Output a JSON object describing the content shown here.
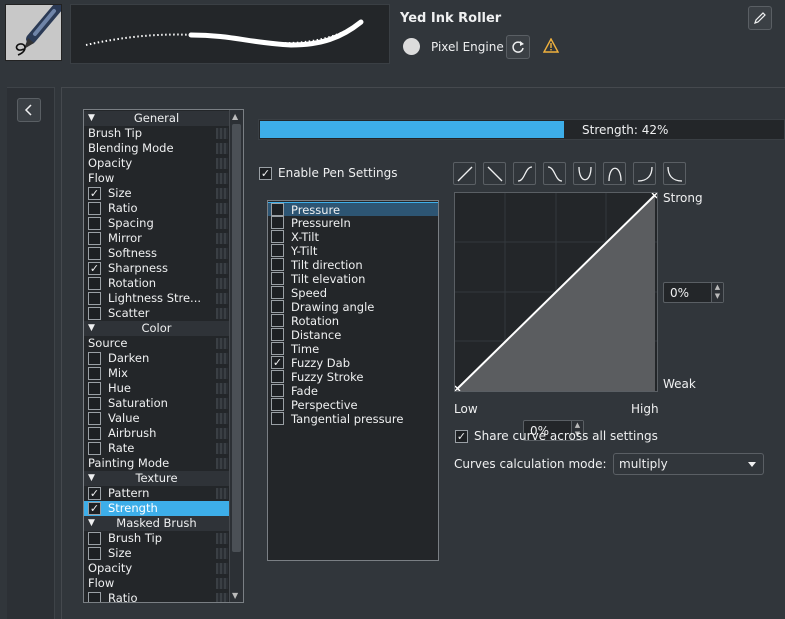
{
  "header": {
    "preset_name": "Yed Ink Roller",
    "engine_label": "Pixel Engine"
  },
  "options": [
    {
      "type": "header",
      "label": "General"
    },
    {
      "type": "plain",
      "label": "Brush Tip"
    },
    {
      "type": "plain",
      "label": "Blending Mode"
    },
    {
      "type": "plain",
      "label": "Opacity"
    },
    {
      "type": "plain",
      "label": "Flow"
    },
    {
      "type": "check",
      "label": "Size",
      "checked": true
    },
    {
      "type": "check",
      "label": "Ratio",
      "checked": false
    },
    {
      "type": "check",
      "label": "Spacing",
      "checked": false
    },
    {
      "type": "check",
      "label": "Mirror",
      "checked": false
    },
    {
      "type": "check",
      "label": "Softness",
      "checked": false
    },
    {
      "type": "check",
      "label": "Sharpness",
      "checked": true
    },
    {
      "type": "check",
      "label": "Rotation",
      "checked": false
    },
    {
      "type": "check",
      "label": "Lightness Stre...",
      "checked": false
    },
    {
      "type": "check",
      "label": "Scatter",
      "checked": false
    },
    {
      "type": "header",
      "label": "Color"
    },
    {
      "type": "plain",
      "label": "Source"
    },
    {
      "type": "check",
      "label": "Darken",
      "checked": false
    },
    {
      "type": "check",
      "label": "Mix",
      "checked": false
    },
    {
      "type": "check",
      "label": "Hue",
      "checked": false
    },
    {
      "type": "check",
      "label": "Saturation",
      "checked": false
    },
    {
      "type": "check",
      "label": "Value",
      "checked": false
    },
    {
      "type": "check",
      "label": "Airbrush",
      "checked": false
    },
    {
      "type": "check",
      "label": "Rate",
      "checked": false
    },
    {
      "type": "plain",
      "label": "Painting Mode"
    },
    {
      "type": "header",
      "label": "Texture"
    },
    {
      "type": "check",
      "label": "Pattern",
      "checked": true
    },
    {
      "type": "check",
      "label": "Strength",
      "checked": true,
      "selected": true
    },
    {
      "type": "header",
      "label": "Masked Brush"
    },
    {
      "type": "check",
      "label": "Brush Tip",
      "checked": false
    },
    {
      "type": "check",
      "label": "Size",
      "checked": false
    },
    {
      "type": "plain",
      "label": "Opacity"
    },
    {
      "type": "plain",
      "label": "Flow"
    },
    {
      "type": "check",
      "label": "Ratio",
      "checked": false
    }
  ],
  "strength": {
    "label": "Strength:  42%",
    "value_percent": 42
  },
  "pen_settings": {
    "label": "Enable Pen Settings",
    "checked": true
  },
  "sensors": [
    {
      "label": "Pressure",
      "checked": false,
      "selected": true
    },
    {
      "label": "PressureIn",
      "checked": false
    },
    {
      "label": "X-Tilt",
      "checked": false
    },
    {
      "label": "Y-Tilt",
      "checked": false
    },
    {
      "label": "Tilt direction",
      "checked": false
    },
    {
      "label": "Tilt elevation",
      "checked": false
    },
    {
      "label": "Speed",
      "checked": false
    },
    {
      "label": "Drawing angle",
      "checked": false
    },
    {
      "label": "Rotation",
      "checked": false
    },
    {
      "label": "Distance",
      "checked": false
    },
    {
      "label": "Time",
      "checked": false
    },
    {
      "label": "Fuzzy Dab",
      "checked": true
    },
    {
      "label": "Fuzzy Stroke",
      "checked": false
    },
    {
      "label": "Fade",
      "checked": false
    },
    {
      "label": "Perspective",
      "checked": false
    },
    {
      "label": "Tangential pressure",
      "checked": false
    }
  ],
  "curve_presets": [
    "linear-curve-icon",
    "reverse-linear-curve-icon",
    "s-curve-icon",
    "reverse-s-curve-icon",
    "u-curve-icon",
    "arch-curve-icon",
    "j-curve-icon",
    "reverse-j-curve-icon"
  ],
  "curve": {
    "strong_label": "Strong",
    "weak_label": "Weak",
    "low_label": "Low",
    "high_label": "High",
    "y_value": "0%",
    "x_value": "0%",
    "points": [
      [
        0,
        0
      ],
      [
        1,
        1
      ]
    ]
  },
  "share_curve": {
    "label": "Share curve across all settings",
    "checked": true
  },
  "calc_mode": {
    "label": "Curves calculation mode:",
    "value": "multiply"
  },
  "colors": {
    "accent": "#3daee9",
    "background": "#31363b",
    "warning": "#f0b13d"
  }
}
